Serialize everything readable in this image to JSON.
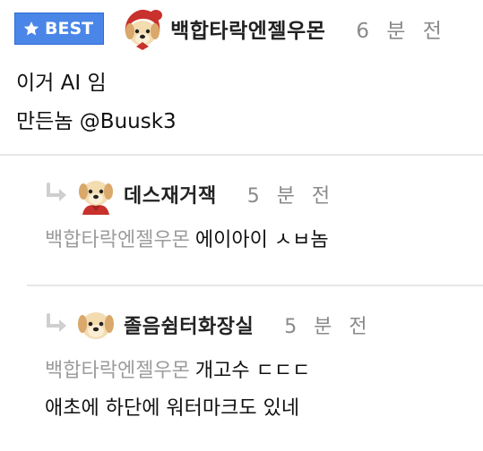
{
  "post": {
    "badge": "BEST",
    "username": "백합타락엔젤우몬",
    "time": "6 분 전",
    "lines": [
      "이거 AI 임",
      "만든놈 @Buusk3"
    ]
  },
  "replies": [
    {
      "username": "데스재거잭",
      "time": "5 분 전",
      "avatar": "dog-red-hood",
      "mention": "백합타락엔젤우몬",
      "lines": [
        "에이아이 ㅅㅂ놈"
      ]
    },
    {
      "username": "졸음쉼터화장실",
      "time": "5 분 전",
      "avatar": "dog-plain",
      "mention": "백합타락엔젤우몬",
      "lines": [
        "개고수 ㄷㄷㄷ",
        "애초에 하단에 워터마크도 있네"
      ]
    }
  ],
  "icons": {
    "badge": "star-icon",
    "reply": "reply-arrow-icon"
  },
  "colors": {
    "badge_bg": "#4a86e8",
    "mention": "#9c9c9c",
    "time": "#8a8a8a",
    "hood": "#c8312c",
    "reply_arrow": "#cfcfcf"
  }
}
